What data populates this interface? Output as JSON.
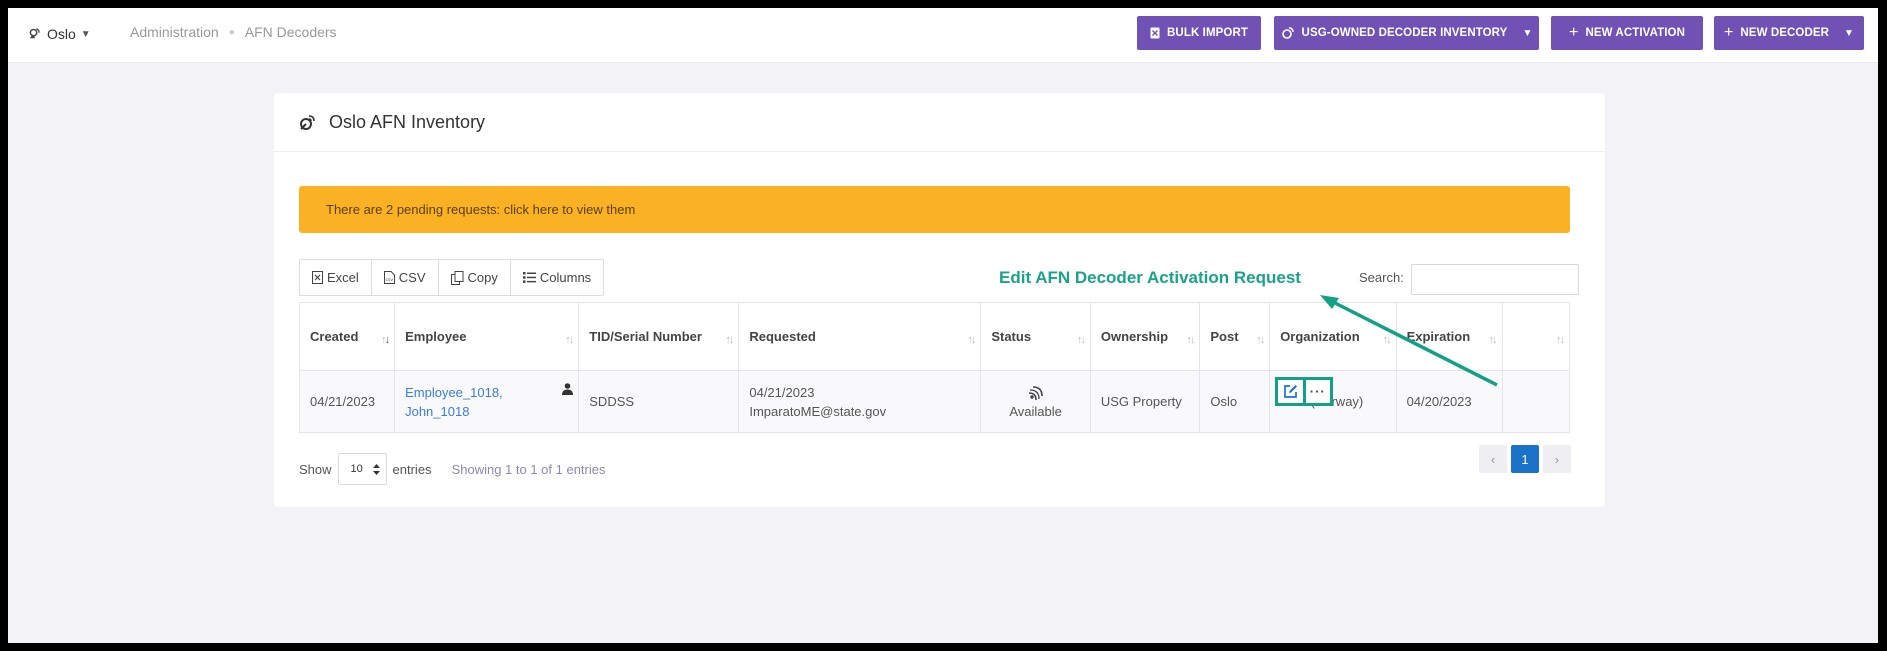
{
  "header": {
    "location": "Oslo",
    "breadcrumbs": [
      "Administration",
      "AFN Decoders"
    ],
    "buttons": {
      "bulk_import": "BULK IMPORT",
      "inventory": "USG-OWNED DECODER INVENTORY",
      "new_activation": "NEW ACTIVATION",
      "new_decoder": "NEW DECODER"
    }
  },
  "card": {
    "title": "Oslo AFN Inventory",
    "alert": "There are 2 pending requests: click here to view them",
    "toolbar": [
      "Excel",
      "CSV",
      "Copy",
      "Columns"
    ],
    "search_label": "Search:",
    "search_value": "",
    "annotation": "Edit AFN Decoder Activation Request",
    "columns": [
      "Created",
      "Employee",
      "TID/Serial Number",
      "Requested",
      "Status",
      "Ownership",
      "Post",
      "Organization",
      "Expiration",
      ""
    ],
    "rows": [
      {
        "created": "04/21/2023",
        "employee_line1": "Employee_1018,",
        "employee_line2": "John_1018",
        "tid": "SDDSS",
        "requested_date": "04/21/2023",
        "requested_by": "ImparatoME@state.gov",
        "status": "Available",
        "ownership": "USG Property",
        "post": "Oslo",
        "organization": "Oslo (Norway)",
        "expiration": "04/20/2023"
      }
    ],
    "footer": {
      "show": "Show",
      "page_length": "10",
      "entries": "entries",
      "info": "Showing 1 to 1 of 1 entries",
      "current_page": "1"
    }
  },
  "colors": {
    "accent": "#7251b5",
    "alert": "#fbb124",
    "annotation": "#1aa38a",
    "link": "#3b7dd8",
    "page_active": "#1a73c8"
  },
  "icons": [
    "antenna-icon",
    "satellite-dish-icon",
    "excel-icon",
    "csv-icon",
    "copy-icon",
    "columns-icon",
    "person-icon",
    "wifi-status-icon",
    "edit-icon",
    "more-icon"
  ]
}
